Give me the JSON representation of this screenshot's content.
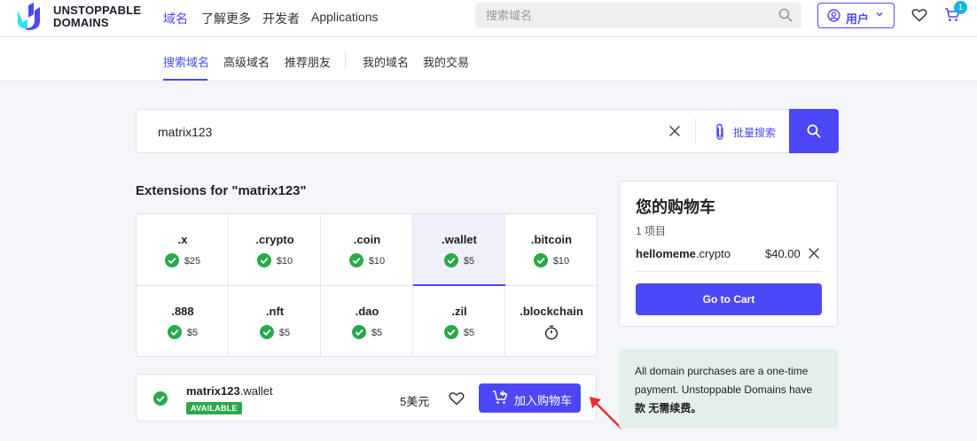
{
  "brand": {
    "line1": "UNSTOPPABLE",
    "line2": "DOMAINS"
  },
  "topnav": [
    {
      "label": "域名",
      "active": true
    },
    {
      "label": "了解更多"
    },
    {
      "label": "开发者"
    },
    {
      "label": "Applications"
    }
  ],
  "search": {
    "placeholder": "搜索域名"
  },
  "user": {
    "label": "用户"
  },
  "cart_badge": "1",
  "subnav": [
    {
      "label": "搜索域名",
      "active": true
    },
    {
      "label": "高级域名"
    },
    {
      "label": "推荐朋友"
    },
    {
      "label": "我的域名"
    },
    {
      "label": "我的交易"
    }
  ],
  "main_search": {
    "value": "matrix123",
    "bulk_label": "批量搜索"
  },
  "extensions_title": "Extensions for \"matrix123\"",
  "extensions": [
    {
      "tld": ".x",
      "price": "$25",
      "status": "available"
    },
    {
      "tld": ".crypto",
      "price": "$10",
      "status": "available"
    },
    {
      "tld": ".coin",
      "price": "$10",
      "status": "available"
    },
    {
      "tld": ".wallet",
      "price": "$5",
      "status": "available",
      "selected": true
    },
    {
      "tld": ".bitcoin",
      "price": "$10",
      "status": "available"
    },
    {
      "tld": ".888",
      "price": "$5",
      "status": "available"
    },
    {
      "tld": ".nft",
      "price": "$5",
      "status": "available"
    },
    {
      "tld": ".dao",
      "price": "$5",
      "status": "available"
    },
    {
      "tld": ".zil",
      "price": "$5",
      "status": "available"
    },
    {
      "tld": ".blockchain",
      "price": "",
      "status": "pending"
    }
  ],
  "result": {
    "name": "matrix123",
    "ext": ".wallet",
    "badge": "AVAILABLE",
    "price": "5美元",
    "add_label": "加入购物车"
  },
  "cart": {
    "title": "您的购物车",
    "count": "1 项目",
    "item_name": "hellomeme",
    "item_ext": ".crypto",
    "item_price": "$40.00",
    "button": "Go to Cart"
  },
  "note": {
    "text": "All domain purchases are a one-time payment. Unstoppable Domains have ",
    "bold": "款 无需续费。"
  },
  "colors": {
    "accent": "#4c47f7",
    "success": "#2aa84a",
    "badge": "#19b1f0",
    "note_bg": "#e3efe9"
  }
}
